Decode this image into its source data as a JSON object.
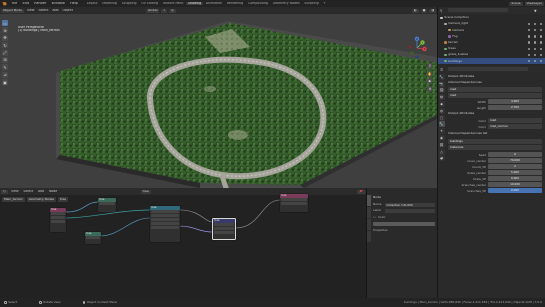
{
  "topbar": {
    "menus": [
      "File",
      "Edit",
      "Render",
      "Window",
      "Help"
    ],
    "workspaces": [
      "Layout",
      "Modeling",
      "Sculpting",
      "UV Editing",
      "Texture Paint",
      "Shading",
      "Animation",
      "Rendering",
      "Compositing",
      "Geometry Nodes",
      "Scripting"
    ],
    "active_workspace": "Shading",
    "scene": "Scene",
    "view_layer": "ViewLayer"
  },
  "viewport": {
    "mode": "Object Mode",
    "menus": [
      "View",
      "Select",
      "Add",
      "Object"
    ],
    "orientation": "Global",
    "info_line1": "User Perspective",
    "info_line2": "(1) buildings | Main_terrain",
    "tools": [
      "select-tool-icon",
      "cursor-tool-icon",
      "move-tool-icon",
      "rotate-tool-icon",
      "scale-tool-icon",
      "transform-tool-icon",
      "annotate-tool-icon",
      "measure-tool-icon",
      "add-cube-tool-icon"
    ],
    "gizmo": {
      "x": "X",
      "y": "Y",
      "z": "Z"
    }
  },
  "node_editor": {
    "menus": [
      "View",
      "Select",
      "Add",
      "Node"
    ],
    "breadcrumb": [
      "Main_terrain",
      "Geometry Nodes",
      "tree"
    ],
    "node_title": "tree",
    "node_colors": [
      "#7a3b5a",
      "#3a6b5a",
      "#2e6a7a",
      "#3a3a6a"
    ]
  },
  "node_side": {
    "title": "Node",
    "name_label": "Name",
    "name_value": "Collection Info.004",
    "label_label": "Label",
    "color_label": "Color",
    "properties_label": "Properties"
  },
  "outliner": {
    "rows": [
      {
        "label": "Scene Collection",
        "color": "#cfcfcf",
        "selected": false
      },
      {
        "label": "Camera_light",
        "color": "#b0b0b0",
        "selected": false
      },
      {
        "label": "Camera",
        "color": "#c0a060",
        "selected": false
      },
      {
        "label": "Fog",
        "color": "#9060b0",
        "selected": false
      },
      {
        "label": "terrain",
        "color": "#c08040",
        "selected": false
      },
      {
        "label": "trees",
        "color": "#6fb070",
        "selected": false
      },
      {
        "label": "grass_bushes",
        "color": "#6fb070",
        "selected": false
      },
      {
        "label": "buildings",
        "color": "#6fb070",
        "selected": true
      }
    ]
  },
  "properties": {
    "modifier_name": "road",
    "sections": [
      "Output Attributes",
      "Internal Dependencies",
      "Output Attributes",
      "Internal Dependencies list"
    ],
    "road": {
      "width_label": "Width",
      "width_value": "4.900",
      "length_label": "length",
      "length_value": "2.700"
    },
    "attr": {
      "color_label": "Color",
      "color_value": "road",
      "color2_label": "Color",
      "color2_value": "road_normal"
    },
    "buildings_name": "buildings",
    "buildings_sub": "Instances",
    "rows": [
      {
        "label": "Seed",
        "value": "0",
        "blue": false
      },
      {
        "label": "cover_render",
        "value": "70.000",
        "blue": false
      },
      {
        "label": "Count_VP",
        "value": "2",
        "blue": false
      },
      {
        "label": "Scale_render",
        "value": "5.000",
        "blue": false
      },
      {
        "label": "Scale_VP",
        "value": "0.000",
        "blue": false
      },
      {
        "label": "branches_render",
        "value": "10.000",
        "blue": false
      },
      {
        "label": "branches_VP",
        "value": "0.000",
        "blue": true
      }
    ]
  },
  "statusbar": {
    "select": "Select",
    "rotate": "Rotate View",
    "context": "Object Context Menu",
    "stats": "buildings | Main_terrain | Verts:985,845 | Faces:1,211,549 | Tris:2,413,040 | Objects:1/28 | 3.5.0"
  }
}
